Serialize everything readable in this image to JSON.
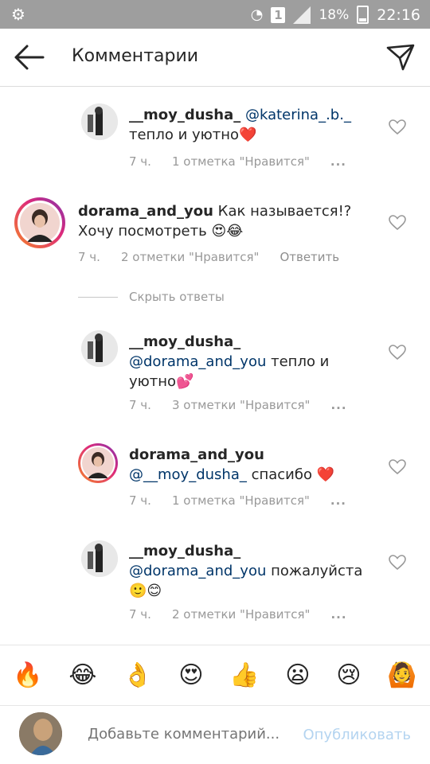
{
  "status_bar": {
    "battery": "18%",
    "time": "22:16",
    "sim": "1"
  },
  "header": {
    "title": "Комментарии"
  },
  "comments": [
    {
      "username": "__moy_dusha_",
      "mention": "@katerina_.b._",
      "text": "тепло и уютно",
      "emoji": "❤️",
      "time": "7 ч.",
      "likes": "1 отметка \"Нравится\"",
      "more": "..."
    },
    {
      "username": "dorama_and_you",
      "mention": "",
      "text": "Как называется!? Хочу посмотреть",
      "emoji": "😍😂",
      "time": "7 ч.",
      "likes": "2 отметки \"Нравится\"",
      "reply": "Ответить"
    },
    {
      "username": "__moy_dusha_",
      "mention": "@dorama_and_you",
      "text": "тепло и уютно",
      "emoji": "💕",
      "time": "7 ч.",
      "likes": "3 отметки \"Нравится\"",
      "more": "..."
    },
    {
      "username": "dorama_and_you",
      "mention": "@__moy_dusha_",
      "text": "спасибо",
      "emoji": "❤️",
      "time": "7 ч.",
      "likes": "1 отметка \"Нравится\"",
      "more": "..."
    },
    {
      "username": "__moy_dusha_",
      "mention": "@dorama_and_you",
      "text": "пожалуйста",
      "emoji": "🙂😊",
      "time": "7 ч.",
      "likes": "2 отметки \"Нравится\"",
      "more": "..."
    }
  ],
  "hide_replies": "Скрыть ответы",
  "emoji_bar": [
    "🔥",
    "😂",
    "👌",
    "😍",
    "👍",
    "😦",
    "😢",
    "🙆"
  ],
  "composer": {
    "placeholder": "Добавьте комментарий...",
    "post_label": "Опубликовать"
  },
  "colors": {
    "mention": "#003569",
    "meta": "#999999",
    "post_disabled": "#b4d4f0"
  }
}
